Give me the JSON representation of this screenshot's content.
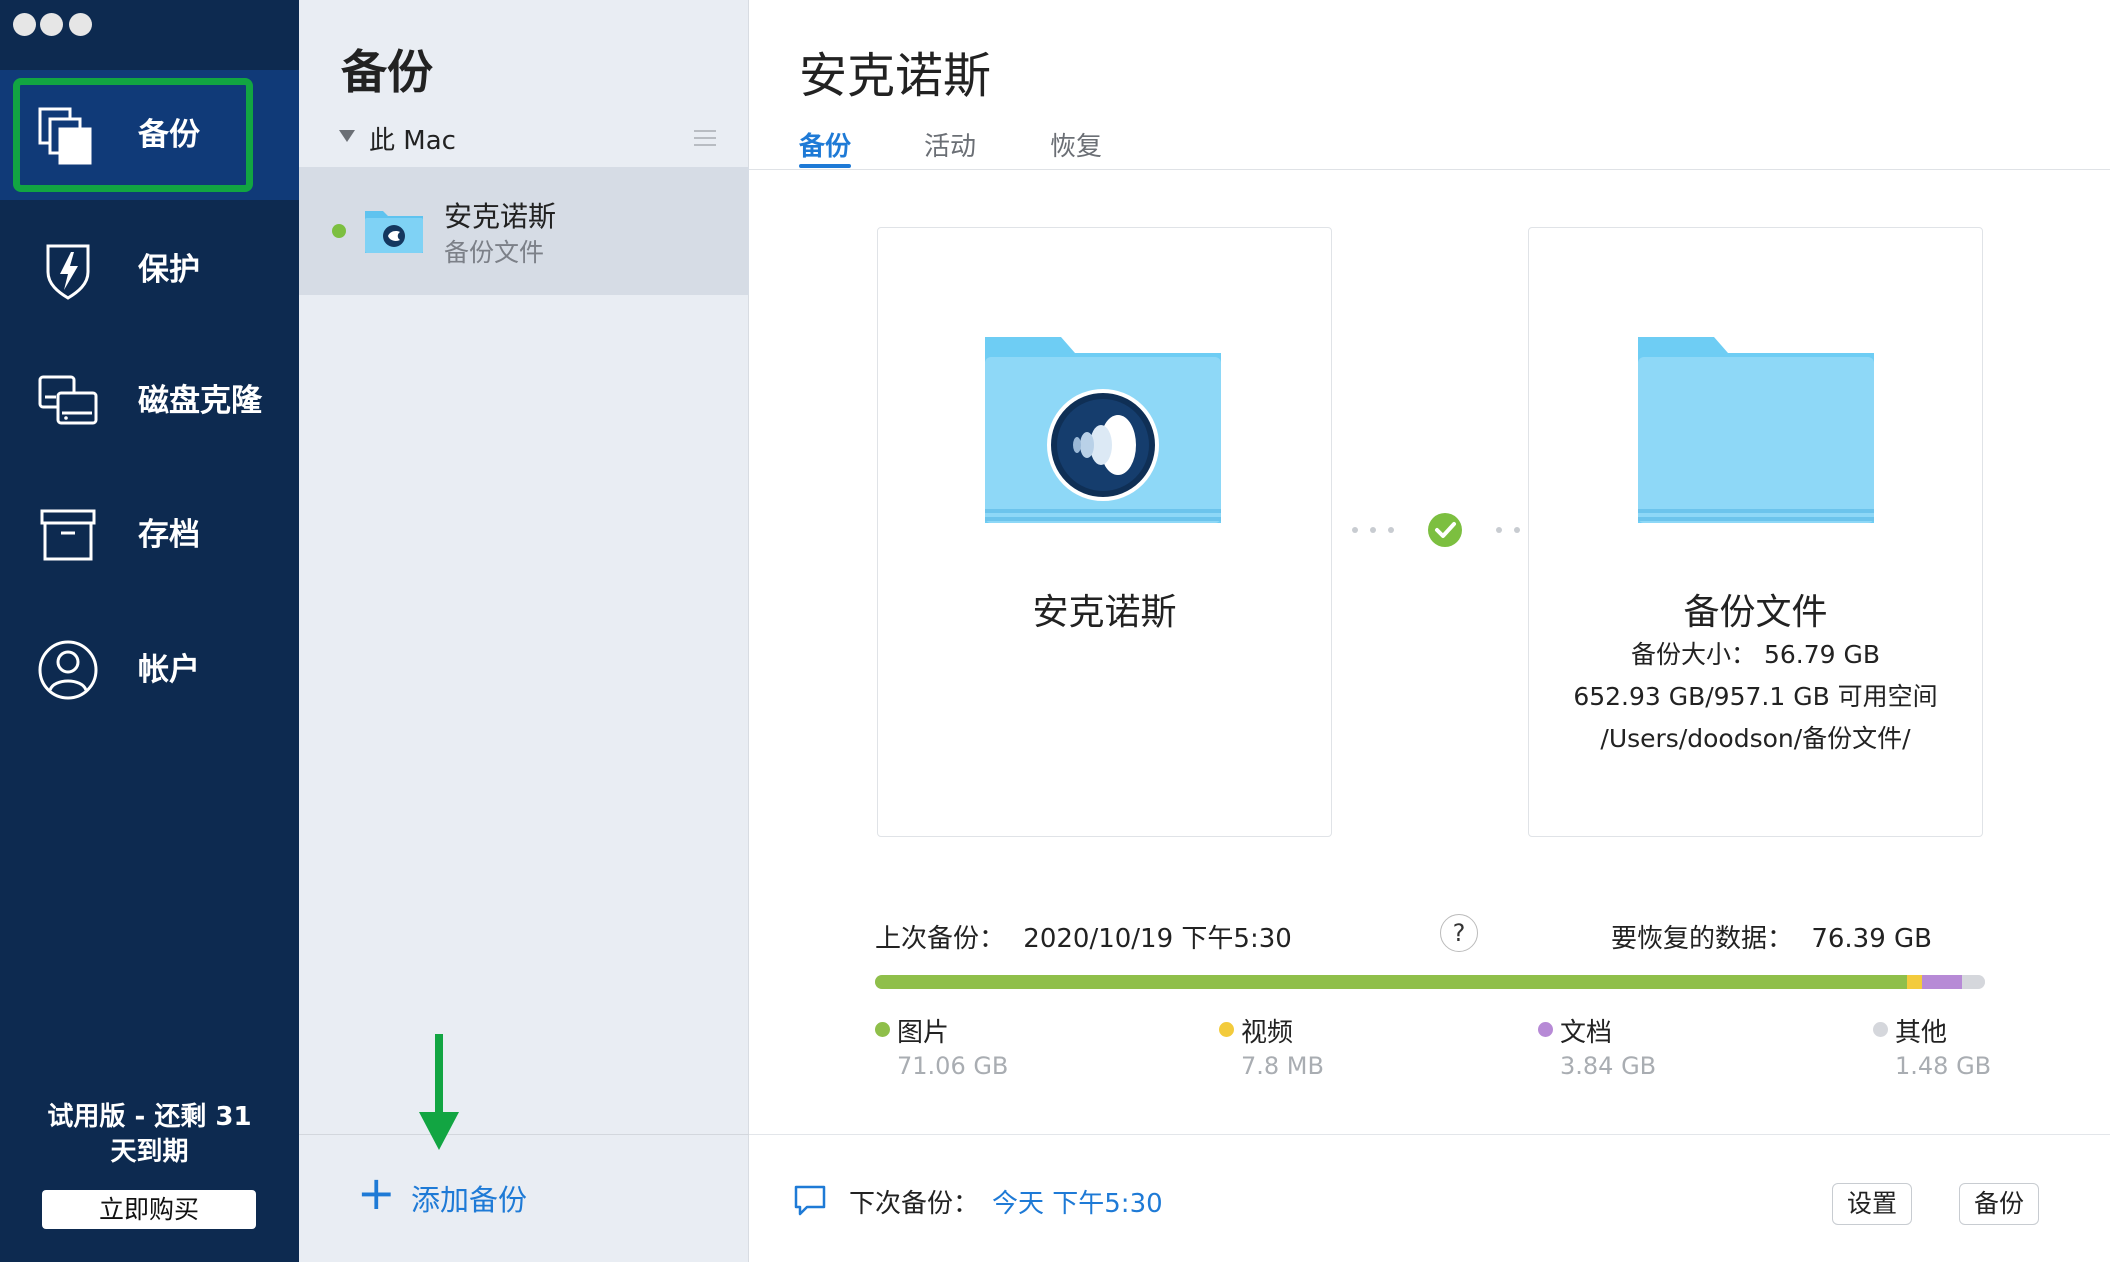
{
  "sidebar": {
    "items": [
      {
        "label": "备份",
        "icon": "copy-icon",
        "active": true
      },
      {
        "label": "保护",
        "icon": "shield-icon",
        "active": false
      },
      {
        "label": "磁盘克隆",
        "icon": "disk-clone-icon",
        "active": false
      },
      {
        "label": "存档",
        "icon": "archive-icon",
        "active": false
      },
      {
        "label": "帐户",
        "icon": "account-icon",
        "active": false
      }
    ],
    "trial_line1": "试用版 - 还剩 31",
    "trial_line2": "天到期",
    "buy_label": "立即购买"
  },
  "list": {
    "title": "备份",
    "group_label": "此 Mac",
    "items": [
      {
        "name": "安克诺斯",
        "destination": "备份文件",
        "status": "ok"
      }
    ],
    "add_label": "添加备份"
  },
  "main": {
    "title": "安克诺斯",
    "tabs": [
      {
        "label": "备份",
        "active": true
      },
      {
        "label": "活动",
        "active": false
      },
      {
        "label": "恢复",
        "active": false
      }
    ],
    "source": {
      "name": "安克诺斯"
    },
    "destination": {
      "name": "备份文件",
      "size_line": "备份大小： 56.79 GB",
      "space_line": "652.93 GB/957.1 GB 可用空间",
      "path_line": "/Users/doodson/备份文件/"
    },
    "last_backup_label": "上次备份：",
    "last_backup_value": "2020/10/19 下午5:30",
    "restore_label": "要恢复的数据：",
    "restore_value": "76.39 GB",
    "help_label": "?",
    "breakdown": [
      {
        "name": "图片",
        "size": "71.06 GB",
        "color": "#8fbf4a",
        "fraction": 0.93
      },
      {
        "name": "视频",
        "size": "7.8 MB",
        "color": "#f3cb3c",
        "fraction": 0.013
      },
      {
        "name": "文档",
        "size": "3.84 GB",
        "color": "#b78ad6",
        "fraction": 0.036
      },
      {
        "name": "其他",
        "size": "1.48 GB",
        "color": "#d5d7dc",
        "fraction": 0.021
      }
    ]
  },
  "bottom": {
    "next_label": "下次备份：",
    "next_value": "今天 下午5:30",
    "settings_label": "设置",
    "backup_label": "备份"
  },
  "colors": {
    "accent": "#1e7ad6",
    "sidebar_bg": "#0d2a50",
    "sidebar_active": "#103a78",
    "highlight": "#12a542"
  }
}
